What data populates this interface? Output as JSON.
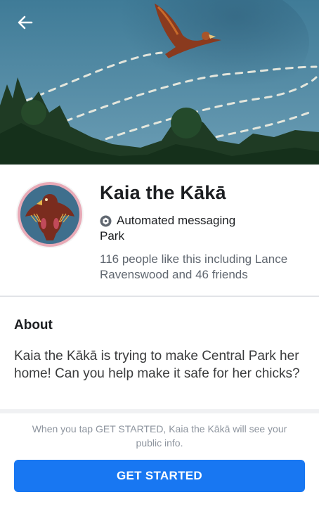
{
  "header": {
    "back_icon": "arrow-left-icon"
  },
  "profile": {
    "name": "Kaia the Kākā",
    "badge_icon": "automated-bot-icon",
    "badge_label": "Automated messaging",
    "category": "Park",
    "likes_text": "116 people like this including Lance Ravenswood and 46 friends"
  },
  "about": {
    "title": "About",
    "text": "Kaia the Kākā is trying to make Central Park her home! Can you help make it safe for her chicks?"
  },
  "footer": {
    "notice": "When you tap GET STARTED, Kaia the Kākā will see your public info.",
    "button_label": "GET STARTED"
  },
  "colors": {
    "accent": "#1877f2",
    "sky": "#4f7f98",
    "avatar_bg": "#3f6f8d"
  }
}
